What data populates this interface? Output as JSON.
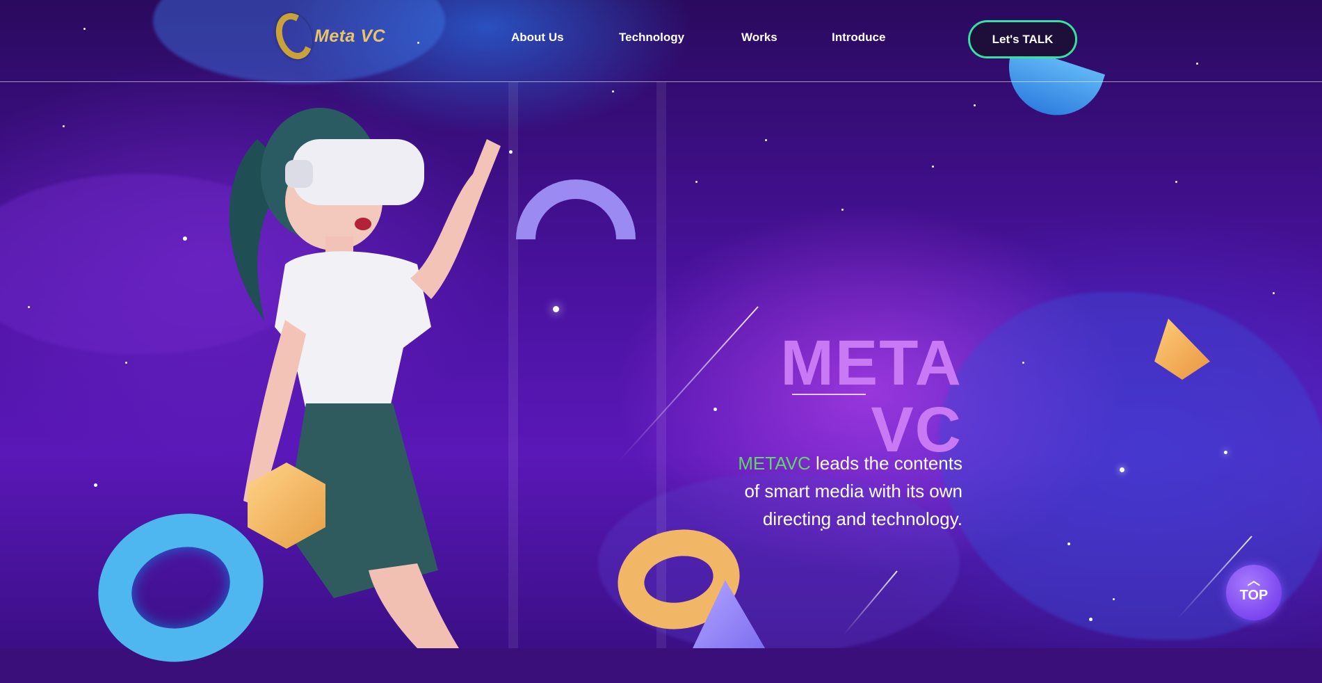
{
  "header": {
    "logo_text": "Meta VC",
    "nav": [
      {
        "label": "About Us"
      },
      {
        "label": "Technology"
      },
      {
        "label": "Works"
      },
      {
        "label": "Introduce"
      }
    ],
    "cta_label": "Let's TALK"
  },
  "hero": {
    "title_line1": "META",
    "title_line2": "VC",
    "brand": "METAVC",
    "desc_part1": " leads the contents",
    "desc_line2": "of smart media with its own",
    "desc_line3": "directing and technology."
  },
  "top_button": {
    "label": "TOP"
  },
  "colors": {
    "title": "#c879f3",
    "brand_green": "#5fd66a",
    "cta_border": "#35e3a0",
    "logo_gold": "#e8c46a"
  },
  "icons": [
    "logo-mark-icon",
    "chevron-up-icon"
  ]
}
